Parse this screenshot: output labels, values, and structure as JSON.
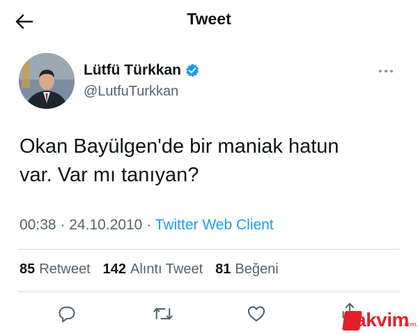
{
  "header": {
    "title": "Tweet"
  },
  "author": {
    "name": "Lütfü Türkkan",
    "handle": "@LutfuTurkkan"
  },
  "tweet": {
    "text_line1": "Okan Bayülgen'de bir maniak hatun",
    "text_line2": "var. Var mı tanıyan?"
  },
  "meta": {
    "time": "00:38",
    "sep1": "·",
    "date": "24.10.2010",
    "sep2": "·",
    "source": "Twitter Web Client"
  },
  "stats": {
    "retweets": {
      "count": "85",
      "label": "Retweet"
    },
    "quotes": {
      "count": "142",
      "label": "Alıntı Tweet"
    },
    "likes": {
      "count": "81",
      "label": "Beğeni"
    }
  },
  "watermark": {
    "text": "akvim",
    "suffix": ".com.tr"
  },
  "colors": {
    "accent": "#1d9bf0",
    "text": "#0f1419",
    "muted": "#536471",
    "watermark": "#e32028"
  },
  "icons": [
    "back-arrow-icon",
    "verified-badge-icon",
    "more-icon",
    "reply-icon",
    "retweet-icon",
    "like-icon",
    "share-icon"
  ]
}
